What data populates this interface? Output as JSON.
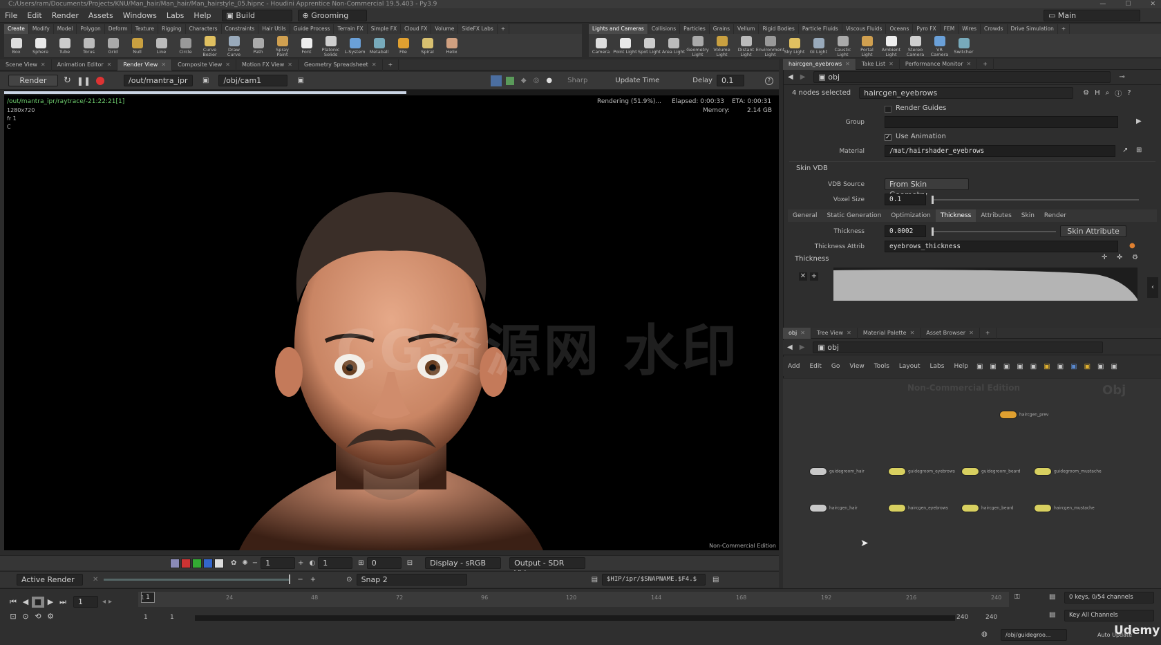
{
  "titlebar": {
    "text": "C:/Users/ram/Documents/Projects/KNU/Man_hair/Man_hair/Man_hairstyle_05.hipnc - Houdini Apprentice Non-Commercial 19.5.403 - Py3.9"
  },
  "menubar": {
    "items": [
      "File",
      "Edit",
      "Render",
      "Assets",
      "Windows",
      "Labs",
      "Help"
    ],
    "desktop_left": "Build",
    "desktop_mid": "Grooming",
    "desktop_right": "Main"
  },
  "shelf_left": {
    "tabs": [
      "Create",
      "Modify",
      "Model",
      "Polygon",
      "Deform",
      "Texture",
      "Rigging",
      "Characters",
      "Constraints",
      "Hair Utils",
      "Guide Process",
      "Terrain FX",
      "Simple FX",
      "Cloud FX",
      "Volume",
      "SideFX Labs"
    ],
    "tools": [
      {
        "label": "Box",
        "icon": "box-icon"
      },
      {
        "label": "Sphere",
        "icon": "sphere-icon"
      },
      {
        "label": "Tube",
        "icon": "tube-icon"
      },
      {
        "label": "Torus",
        "icon": "torus-icon"
      },
      {
        "label": "Grid",
        "icon": "grid-icon"
      },
      {
        "label": "Null",
        "icon": "null-icon"
      },
      {
        "label": "Line",
        "icon": "line-icon"
      },
      {
        "label": "Circle",
        "icon": "circle-icon"
      },
      {
        "label": "Curve Bezier",
        "icon": "curve-bezier-icon"
      },
      {
        "label": "Draw Curve",
        "icon": "draw-curve-icon"
      },
      {
        "label": "Path",
        "icon": "path-icon"
      },
      {
        "label": "Spray Paint",
        "icon": "spray-paint-icon"
      },
      {
        "label": "Font",
        "icon": "font-icon"
      },
      {
        "label": "Platonic Solids",
        "icon": "platonic-icon"
      },
      {
        "label": "L-System",
        "icon": "lsystem-icon"
      },
      {
        "label": "Metaball",
        "icon": "metaball-icon"
      },
      {
        "label": "File",
        "icon": "file-icon"
      },
      {
        "label": "Spiral",
        "icon": "spiral-icon"
      },
      {
        "label": "Helix",
        "icon": "helix-icon"
      }
    ]
  },
  "shelf_right": {
    "tabs": [
      "Lights and Cameras",
      "Collisions",
      "Particles",
      "Grains",
      "Vellum",
      "Rigid Bodies",
      "Particle Fluids",
      "Viscous Fluids",
      "Oceans",
      "Pyro FX",
      "FEM",
      "Wires",
      "Crowds",
      "Drive Simulation"
    ],
    "tools": [
      {
        "label": "Camera",
        "icon": "camera-icon"
      },
      {
        "label": "Point Light",
        "icon": "point-light-icon"
      },
      {
        "label": "Spot Light",
        "icon": "spot-light-icon"
      },
      {
        "label": "Area Light",
        "icon": "area-light-icon"
      },
      {
        "label": "Geometry Light",
        "icon": "geometry-light-icon"
      },
      {
        "label": "Volume Light",
        "icon": "volume-light-icon"
      },
      {
        "label": "Distant Light",
        "icon": "distant-light-icon"
      },
      {
        "label": "Environment Light",
        "icon": "environment-light-icon"
      },
      {
        "label": "Sky Light",
        "icon": "sky-light-icon"
      },
      {
        "label": "GI Light",
        "icon": "gi-light-icon"
      },
      {
        "label": "Caustic Light",
        "icon": "caustic-light-icon"
      },
      {
        "label": "Portal Light",
        "icon": "portal-light-icon"
      },
      {
        "label": "Ambient Light",
        "icon": "ambient-light-icon"
      },
      {
        "label": "Stereo Camera",
        "icon": "stereo-camera-icon"
      },
      {
        "label": "VR Camera",
        "icon": "vr-camera-icon"
      },
      {
        "label": "Switcher",
        "icon": "switcher-icon"
      }
    ]
  },
  "view_tabs": [
    "Scene View",
    "Animation Editor",
    "Render View",
    "Composite View",
    "Motion FX View",
    "Geometry Spreadsheet"
  ],
  "render_bar": {
    "render_btn": "Render",
    "output_path": "/out/mantra_ipr",
    "camera_path": "/obj/cam1",
    "sharp": "Sharp",
    "update_time": "Update Time",
    "delay_label": "Delay",
    "delay_value": "0.1"
  },
  "viewport": {
    "render_name": "/out/mantra_ipr/raytrace/-21:22:21[1]",
    "resolution": "1280x720",
    "fr": "fr 1",
    "c": "C",
    "status": "Rendering (51.9%)...",
    "elapsed": "Elapsed: 0:00:33",
    "eta": "ETA: 0:00:31",
    "memory_label": "Memory:",
    "memory_value": "2.14 GB",
    "edition": "Non-Commercial Edition",
    "watermark": "CG资源网 水印",
    "progress": 0.519
  },
  "vp_bottom": {
    "frame_a": "1",
    "frame_b": "1",
    "frame_c": "0",
    "display": "Display - sRGB",
    "output": "Output - SDR Video",
    "active_render": "Active Render",
    "snap": "Snap 2",
    "save_path": "$HIP/ipr/$SNAPNAME.$F4.$"
  },
  "param_tabs": [
    "haircgen_eyebrows",
    "Take List",
    "Performance Monitor"
  ],
  "param": {
    "path": "obj",
    "nodes_selected": "4 nodes selected",
    "node_name": "haircgen_eyebrows",
    "render_guides": "Render Guides",
    "group_label": "Group",
    "use_animation": "Use Animation",
    "material_label": "Material",
    "material_value": "/mat/hairshader_eyebrows",
    "skin_vdb": "Skin VDB",
    "vdb_source_label": "VDB Source",
    "vdb_source_value": "From Skin Geometry",
    "voxel_size_label": "Voxel Size",
    "voxel_size_value": "0.1",
    "subtabs": [
      "General",
      "Static Generation",
      "Optimization",
      "Thickness",
      "Attributes",
      "Skin",
      "Render"
    ],
    "thickness_label": "Thickness",
    "thickness_value": "0.0002",
    "skin_attribute": "Skin Attribute",
    "thickness_attrib_label": "Thickness Attrib",
    "thickness_attrib_value": "eyebrows_thickness",
    "ramp_label": "Thickness"
  },
  "net_tabs": [
    "obj",
    "Tree View",
    "Material Palette",
    "Asset Browser"
  ],
  "net": {
    "path": "obj",
    "menu": [
      "Add",
      "Edit",
      "Go",
      "View",
      "Tools",
      "Layout",
      "Labs",
      "Help"
    ],
    "edition": "Non-Commercial Edition",
    "context": "Obj",
    "nodes": [
      {
        "label": "haircgen_prev",
        "color": "#e0a030"
      },
      {
        "label": "guidegroom_hair",
        "color": "#c8c8c8"
      },
      {
        "label": "guidegroom_eyebrows",
        "color": "#d8d060"
      },
      {
        "label": "guidegroom_beard",
        "color": "#d8d060"
      },
      {
        "label": "guidegroom_mustache",
        "color": "#d8d060"
      },
      {
        "label": "haircgen_hair",
        "color": "#c8c8c8"
      },
      {
        "label": "haircgen_eyebrows",
        "color": "#d8d060"
      },
      {
        "label": "haircgen_beard",
        "color": "#d8d060"
      },
      {
        "label": "haircgen_mustache",
        "color": "#d8d060"
      }
    ]
  },
  "timeline": {
    "frame": "1",
    "ticks": [
      "1",
      "24",
      "48",
      "72",
      "96",
      "120",
      "144",
      "168",
      "192",
      "216",
      "240"
    ],
    "start": "1",
    "start2": "1",
    "end": "240",
    "end2": "240",
    "keys": "0 keys, 0/54 channels",
    "key_all": "Key All Channels",
    "path": "/obj/guidegroo...",
    "auto_update": "Auto Update",
    "brand": "Udemy"
  },
  "colors": {
    "accent_blue": "#3a6ea8",
    "render_bg": "#000000",
    "panel": "#2e2e2e"
  }
}
